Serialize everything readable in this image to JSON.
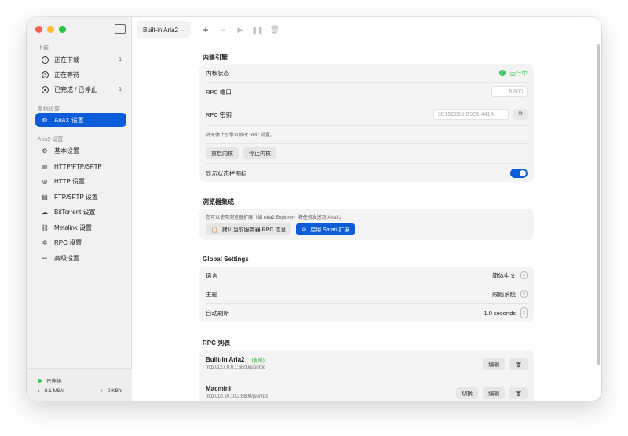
{
  "sidebar": {
    "section_download": "下载",
    "items_download": [
      {
        "label": "正在下载",
        "count": "1"
      },
      {
        "label": "正在等待",
        "count": ""
      },
      {
        "label": "已完成 / 已停止",
        "count": "1"
      }
    ],
    "section_system": "系统设置",
    "item_ariax": "AriaX 设置",
    "section_aria2": "Aria2 设置",
    "items_aria2": [
      {
        "label": "基本设置"
      },
      {
        "label": "HTTP/FTP/SFTP"
      },
      {
        "label": "HTTP 设置"
      },
      {
        "label": "FTP/SFTP 设置"
      },
      {
        "label": "BitTorrent 设置"
      },
      {
        "label": "Metalink 设置"
      },
      {
        "label": "RPC 设置"
      },
      {
        "label": "高级设置"
      }
    ],
    "status": {
      "connected": "已连接",
      "download_speed": "8.1 MB/s",
      "upload_speed": "0 KB/s"
    }
  },
  "toolbar": {
    "engine_select": "Built-in Aria2"
  },
  "builtin": {
    "heading": "内建引擎",
    "kernel_status_label": "内核状态",
    "kernel_status_value": "运行中",
    "rpc_port_label": "RPC 端口",
    "rpc_port_value": "6,800",
    "rpc_secret_label": "RPC 密钥",
    "rpc_secret_value": "9B15C858-B9E6-441A-",
    "stop_hint": "请先停止引擎以修改 RPC 设置。",
    "restart_label": "重启内核",
    "stop_label": "停止内核",
    "statusbar_icon_label": "显示状态栏图标",
    "statusbar_icon_on": true
  },
  "browser": {
    "heading": "浏览器集成",
    "hint": "您可以使用浏览器扩展（如 Aria2 Explorer）将任务发送到 AriaX。",
    "copy_label": "拷贝当前服务器 RPC 信息",
    "enable_label": "启用 Safari 扩展"
  },
  "global": {
    "heading": "Global Settings",
    "language_label": "语言",
    "language_value": "简体中文",
    "theme_label": "主题",
    "theme_value": "跟随系统",
    "refresh_label": "自动刷新",
    "refresh_value": "1.0 seconds"
  },
  "rpc": {
    "heading": "RPC 列表",
    "items": [
      {
        "name": "Built-in Aria2",
        "badge": "(当前)",
        "url": "http://127.0.0.1:6800/jsonrpc",
        "switch": "",
        "edit": "编辑"
      },
      {
        "name": "Macmini",
        "badge": "",
        "url": "http://10.10.10.2:6800/jsonrpc",
        "switch": "切换",
        "edit": "编辑"
      }
    ]
  },
  "colors": {
    "accent": "#0a5cd8",
    "running": "#34c759"
  }
}
